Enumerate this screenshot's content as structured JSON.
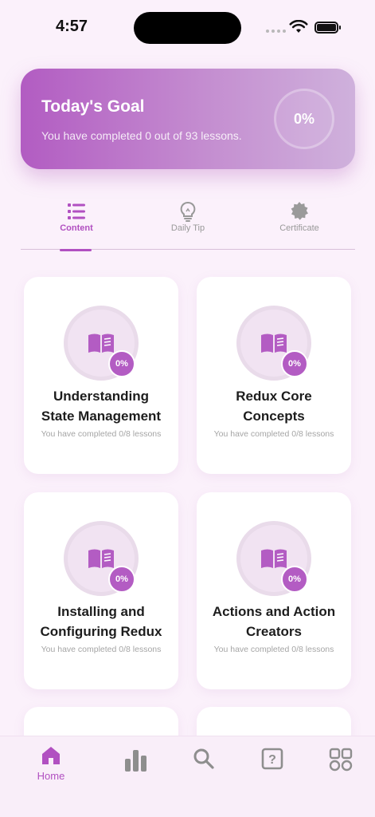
{
  "status_bar": {
    "time": "4:57"
  },
  "goal": {
    "title": "Today's Goal",
    "subtitle": "You have completed 0 out of 93 lessons.",
    "percent": "0%"
  },
  "tabs": [
    {
      "label": "Content",
      "icon": "list-icon",
      "active": true
    },
    {
      "label": "Daily Tip",
      "icon": "lightbulb-icon",
      "active": false
    },
    {
      "label": "Certificate",
      "icon": "badge-icon",
      "active": false
    }
  ],
  "modules": [
    {
      "title_line1": "Understanding",
      "title_line2": "State Management",
      "progress": "You have completed 0/8 lessons",
      "percent": "0%"
    },
    {
      "title_line1": "Redux Core",
      "title_line2": "Concepts",
      "progress": "You have completed 0/8 lessons",
      "percent": "0%"
    },
    {
      "title_line1": "Installing and",
      "title_line2": "Configuring Redux",
      "progress": "You have completed 0/8 lessons",
      "percent": "0%"
    },
    {
      "title_line1": "Actions and Action",
      "title_line2": "Creators",
      "progress": "You have completed 0/8 lessons",
      "percent": "0%"
    }
  ],
  "bottom_nav": [
    {
      "label": "Home",
      "icon": "home-icon",
      "active": true
    },
    {
      "label": "",
      "icon": "stats-icon",
      "active": false
    },
    {
      "label": "",
      "icon": "search-icon",
      "active": false
    },
    {
      "label": "",
      "icon": "help-icon",
      "active": false
    },
    {
      "label": "",
      "icon": "apps-icon",
      "active": false
    }
  ],
  "colors": {
    "accent": "#b150c1",
    "background": "#fbf1fb",
    "card": "#ffffff"
  }
}
